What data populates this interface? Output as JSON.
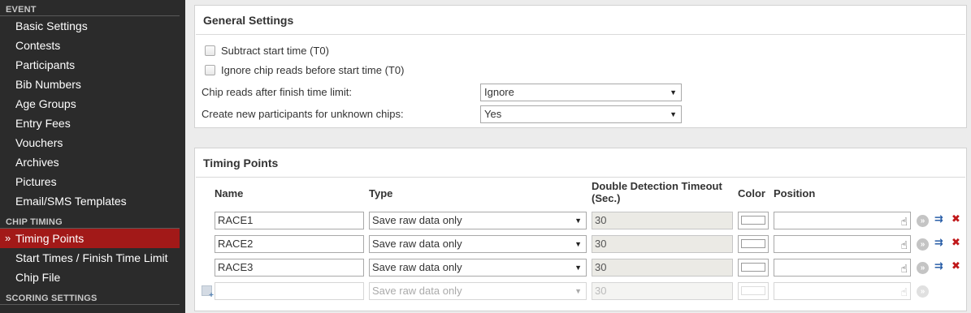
{
  "sidebar": {
    "event_header": "EVENT",
    "event_items": [
      {
        "label": "Basic Settings"
      },
      {
        "label": "Contests"
      },
      {
        "label": "Participants"
      },
      {
        "label": "Bib Numbers"
      },
      {
        "label": "Age Groups"
      },
      {
        "label": "Entry Fees"
      },
      {
        "label": "Vouchers"
      },
      {
        "label": "Archives"
      },
      {
        "label": "Pictures"
      },
      {
        "label": "Email/SMS Templates"
      }
    ],
    "chip_header": "CHIP TIMING",
    "chip_items": [
      {
        "label": "Timing Points",
        "active": true
      },
      {
        "label": "Start Times / Finish Time Limit"
      },
      {
        "label": "Chip File"
      }
    ],
    "scoring_header": "SCORING SETTINGS",
    "active_marker": "»"
  },
  "general": {
    "title": "General Settings",
    "checkbox1_label": "Subtract start time (T0)",
    "checkbox2_label": "Ignore chip reads before start time (T0)",
    "finish_limit_label": "Chip reads after finish time limit:",
    "finish_limit_value": "Ignore",
    "unknown_chips_label": "Create new participants for unknown chips:",
    "unknown_chips_value": "Yes"
  },
  "timing": {
    "title": "Timing Points",
    "columns": {
      "name": "Name",
      "type": "Type",
      "double_detection_1": "Double Detection Timeout",
      "double_detection_2": "(Sec.)",
      "color": "Color",
      "position": "Position"
    },
    "rows": [
      {
        "name": "RACE1",
        "type": "Save raw data only",
        "timeout": "30"
      },
      {
        "name": "RACE2",
        "type": "Save raw data only",
        "timeout": "30"
      },
      {
        "name": "RACE3",
        "type": "Save raw data only",
        "timeout": "30"
      }
    ],
    "new_row": {
      "name": "",
      "type": "Save raw data only",
      "timeout": "30"
    }
  },
  "icons": {
    "dropdown": "▼",
    "hand": "☝",
    "go": "»",
    "link": "⇉",
    "delete": "✖"
  },
  "colors": {
    "sidebar_bg": "#2b2b2b",
    "active_item": "#a21918",
    "page_bg": "#ececec"
  }
}
